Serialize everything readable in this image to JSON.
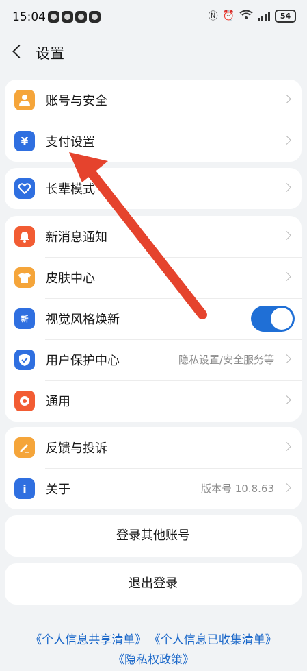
{
  "status_bar": {
    "time": "15:04",
    "battery": "54",
    "wifi_label": "6"
  },
  "header": {
    "title": "设置"
  },
  "groups": [
    {
      "items": [
        {
          "label": "账号与安全",
          "icon": "user-icon",
          "color": "#f5a53a"
        },
        {
          "label": "支付设置",
          "icon": "yen-icon",
          "color": "#2f6fe0"
        }
      ]
    },
    {
      "items": [
        {
          "label": "长辈模式",
          "icon": "heart-icon",
          "color": "#2f6fe0"
        }
      ]
    },
    {
      "items": [
        {
          "label": "新消息通知",
          "icon": "bell-icon",
          "color": "#f25c33"
        },
        {
          "label": "皮肤中心",
          "icon": "shirt-icon",
          "color": "#f5a53a"
        },
        {
          "label": "视觉风格焕新",
          "icon": "style-icon",
          "color": "#2f6fe0",
          "badge": "新",
          "toggle": "on"
        },
        {
          "label": "用户保护中心",
          "icon": "shield-icon",
          "color": "#2f6fe0",
          "value": "隐私设置/安全服务等"
        },
        {
          "label": "通用",
          "icon": "gear-icon",
          "color": "#f25c33"
        }
      ]
    },
    {
      "items": [
        {
          "label": "反馈与投诉",
          "icon": "pencil-icon",
          "color": "#f5a53a"
        },
        {
          "label": "关于",
          "icon": "info-icon",
          "color": "#2f6fe0",
          "value": "版本号 10.8.63"
        }
      ]
    }
  ],
  "buttons": {
    "switch_account": "登录其他账号",
    "logout": "退出登录"
  },
  "footer_links": {
    "shared_list": "《个人信息共享清单》",
    "collected_list": "《个人信息已收集清单》",
    "privacy_policy": "《隐私权政策》"
  },
  "colors": {
    "accent": "#1f6fd6",
    "link": "#1a67c9",
    "annotation_arrow": "#e5432d",
    "background": "#f1f3f5"
  }
}
